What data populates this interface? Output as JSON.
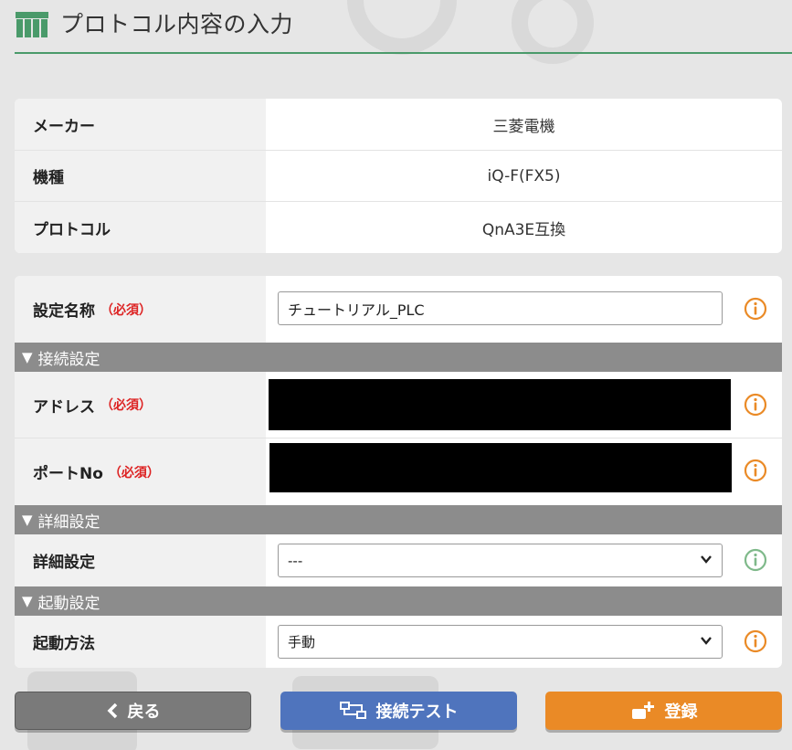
{
  "header": {
    "title": "プロトコル内容の入力"
  },
  "summary": {
    "rows": [
      {
        "label": "メーカー",
        "value": "三菱電機"
      },
      {
        "label": "機種",
        "value": "iQ-F(FX5)"
      },
      {
        "label": "プロトコル",
        "value": "QnA3E互換"
      }
    ]
  },
  "form": {
    "required_mark": "（必須）",
    "setting_name": {
      "label": "設定名称",
      "value": "チュートリアル_PLC"
    },
    "sections": {
      "connection": "接続設定",
      "detail": "詳細設定",
      "startup": "起動設定"
    },
    "address": {
      "label": "アドレス"
    },
    "port": {
      "label": "ポートNo"
    },
    "detail_setting": {
      "label": "詳細設定",
      "selected": "---"
    },
    "startup_method": {
      "label": "起動方法",
      "selected": "手動"
    }
  },
  "buttons": {
    "back": "戻る",
    "test": "接続テスト",
    "register": "登録"
  },
  "colors": {
    "accent_green": "#4a9a6a",
    "info_orange": "#ea8a26",
    "info_green": "#7fb98a",
    "required_red": "#dd2222",
    "btn_back": "#7a7a7a",
    "btn_test": "#4f74bd",
    "btn_register": "#ea8a26"
  }
}
